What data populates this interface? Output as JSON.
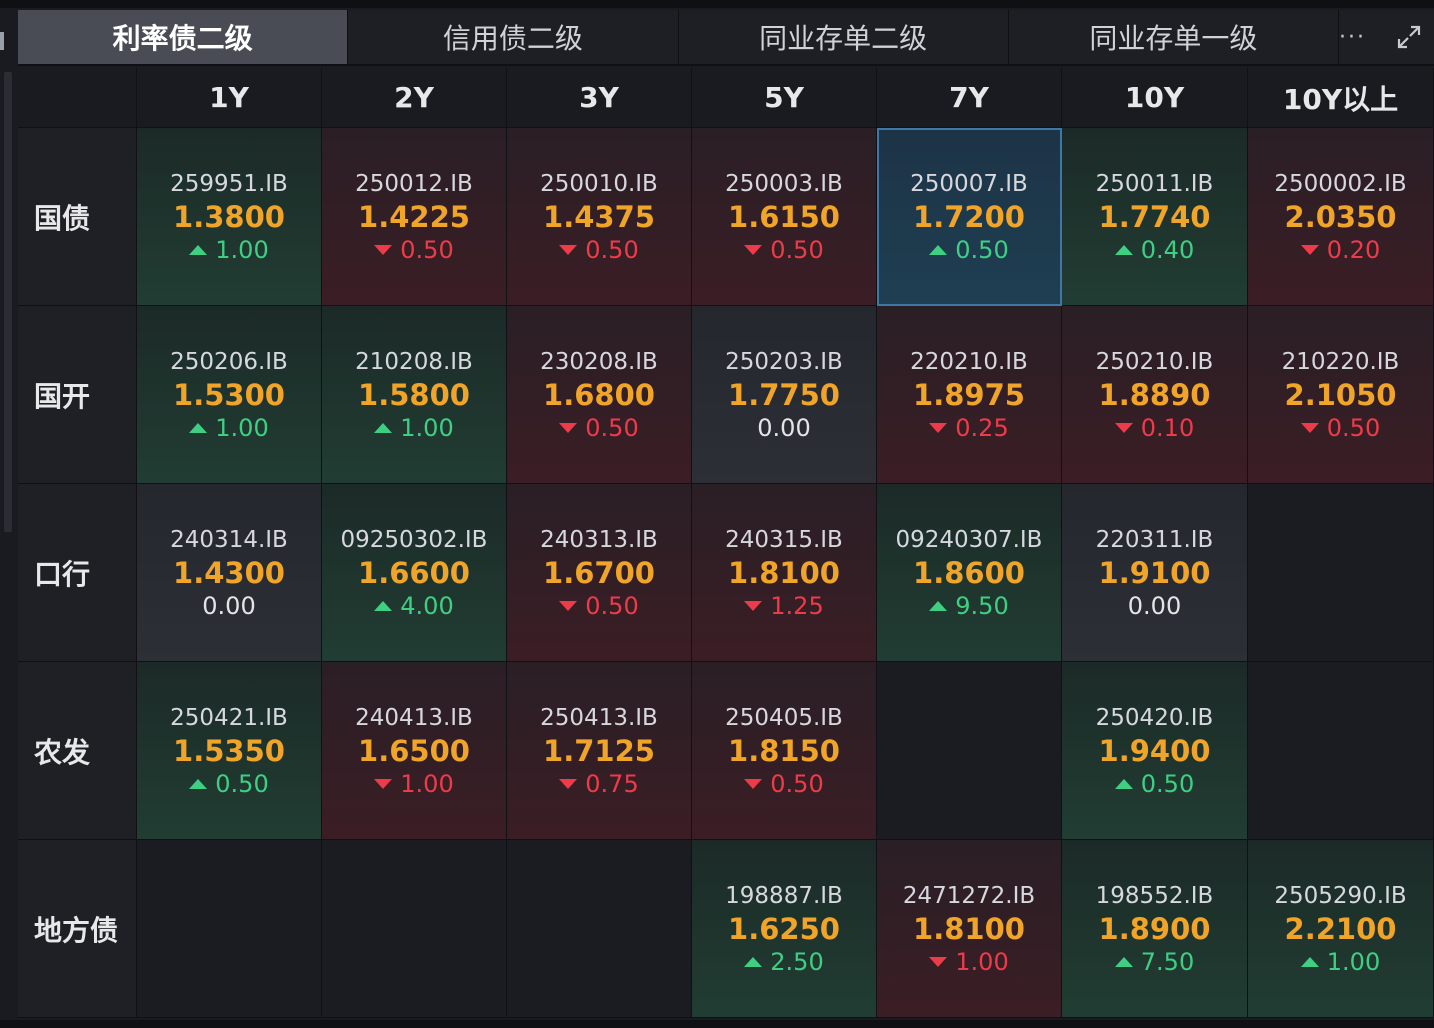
{
  "tabs": [
    {
      "label": "利率债二级",
      "active": true
    },
    {
      "label": "信用债二级",
      "active": false
    },
    {
      "label": "同业存单二级",
      "active": false
    },
    {
      "label": "同业存单一级",
      "active": false
    }
  ],
  "tools": {
    "more_label": "···",
    "more_icon": "more-dots-icon",
    "expand_icon": "expand-icon"
  },
  "colors": {
    "yield": "#f0a528",
    "up": "#3ecf83",
    "down": "#ee3b4a",
    "selected_border": "#3f77a6"
  },
  "columns": [
    "1Y",
    "2Y",
    "3Y",
    "5Y",
    "7Y",
    "10Y",
    "10Y以上"
  ],
  "rows": [
    {
      "label": "国债",
      "cells": [
        {
          "code": "259951.IB",
          "yield": "1.3800",
          "dir": "up",
          "change": "1.00"
        },
        {
          "code": "250012.IB",
          "yield": "1.4225",
          "dir": "down",
          "change": "0.50"
        },
        {
          "code": "250010.IB",
          "yield": "1.4375",
          "dir": "down",
          "change": "0.50"
        },
        {
          "code": "250003.IB",
          "yield": "1.6150",
          "dir": "down",
          "change": "0.50"
        },
        {
          "code": "250007.IB",
          "yield": "1.7200",
          "dir": "up",
          "change": "0.50",
          "selected": true
        },
        {
          "code": "250011.IB",
          "yield": "1.7740",
          "dir": "up",
          "change": "0.40"
        },
        {
          "code": "2500002.IB",
          "yield": "2.0350",
          "dir": "down",
          "change": "0.20"
        }
      ]
    },
    {
      "label": "国开",
      "cells": [
        {
          "code": "250206.IB",
          "yield": "1.5300",
          "dir": "up",
          "change": "1.00"
        },
        {
          "code": "210208.IB",
          "yield": "1.5800",
          "dir": "up",
          "change": "1.00"
        },
        {
          "code": "230208.IB",
          "yield": "1.6800",
          "dir": "down",
          "change": "0.50"
        },
        {
          "code": "250203.IB",
          "yield": "1.7750",
          "dir": "flat",
          "change": "0.00"
        },
        {
          "code": "220210.IB",
          "yield": "1.8975",
          "dir": "down",
          "change": "0.25"
        },
        {
          "code": "250210.IB",
          "yield": "1.8890",
          "dir": "down",
          "change": "0.10"
        },
        {
          "code": "210220.IB",
          "yield": "2.1050",
          "dir": "down",
          "change": "0.50"
        }
      ]
    },
    {
      "label": "口行",
      "cells": [
        {
          "code": "240314.IB",
          "yield": "1.4300",
          "dir": "flat",
          "change": "0.00"
        },
        {
          "code": "09250302.IB",
          "yield": "1.6600",
          "dir": "up",
          "change": "4.00"
        },
        {
          "code": "240313.IB",
          "yield": "1.6700",
          "dir": "down",
          "change": "0.50"
        },
        {
          "code": "240315.IB",
          "yield": "1.8100",
          "dir": "down",
          "change": "1.25"
        },
        {
          "code": "09240307.IB",
          "yield": "1.8600",
          "dir": "up",
          "change": "9.50"
        },
        {
          "code": "220311.IB",
          "yield": "1.9100",
          "dir": "flat",
          "change": "0.00"
        },
        null
      ]
    },
    {
      "label": "农发",
      "cells": [
        {
          "code": "250421.IB",
          "yield": "1.5350",
          "dir": "up",
          "change": "0.50"
        },
        {
          "code": "240413.IB",
          "yield": "1.6500",
          "dir": "down",
          "change": "1.00"
        },
        {
          "code": "250413.IB",
          "yield": "1.7125",
          "dir": "down",
          "change": "0.75"
        },
        {
          "code": "250405.IB",
          "yield": "1.8150",
          "dir": "down",
          "change": "0.50"
        },
        null,
        {
          "code": "250420.IB",
          "yield": "1.9400",
          "dir": "up",
          "change": "0.50"
        },
        null
      ]
    },
    {
      "label": "地方债",
      "cells": [
        null,
        null,
        null,
        {
          "code": "198887.IB",
          "yield": "1.6250",
          "dir": "up",
          "change": "2.50"
        },
        {
          "code": "2471272.IB",
          "yield": "1.8100",
          "dir": "down",
          "change": "1.00"
        },
        {
          "code": "198552.IB",
          "yield": "1.8900",
          "dir": "up",
          "change": "7.50"
        },
        {
          "code": "2505290.IB",
          "yield": "2.2100",
          "dir": "up",
          "change": "1.00"
        }
      ]
    }
  ]
}
